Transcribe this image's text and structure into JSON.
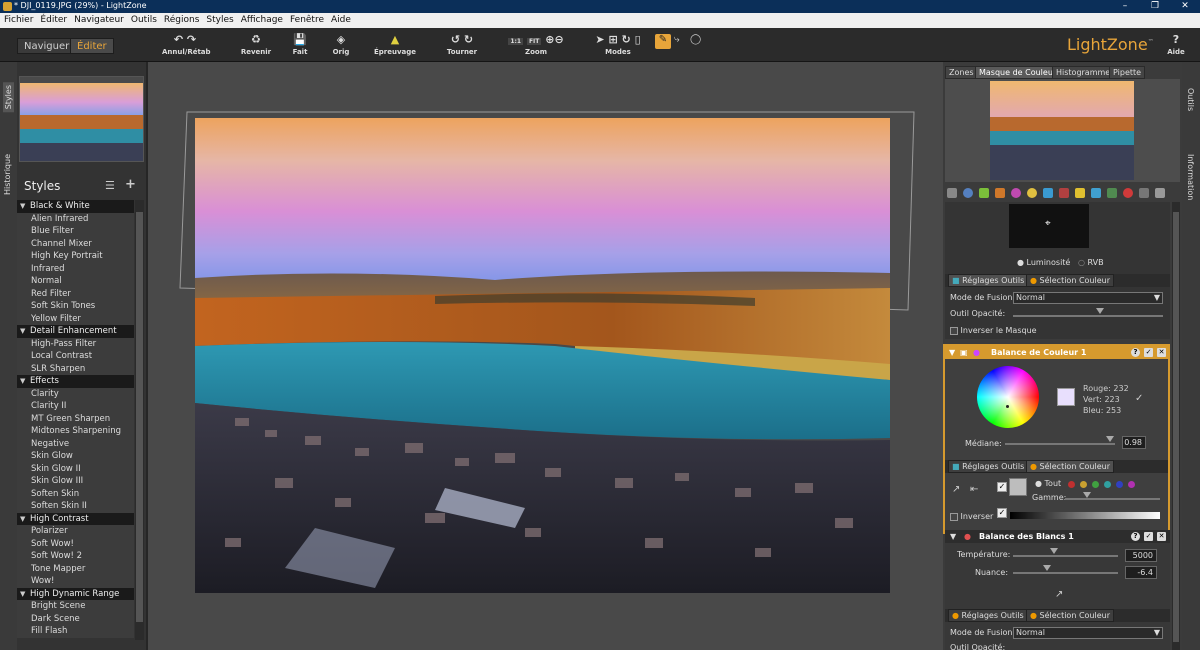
{
  "window": {
    "title": "* DJI_0119.JPG (29%) - LightZone"
  },
  "menu": [
    "Fichier",
    "Éditer",
    "Navigateur",
    "Outils",
    "Régions",
    "Styles",
    "Affichage",
    "Fenêtre",
    "Aide"
  ],
  "modes": {
    "navigate": "Naviguer",
    "edit": "Éditer"
  },
  "toolbar": {
    "undo_redo": "Annul/Rétab",
    "revert": "Revenir",
    "done": "Fait",
    "orig": "Orig",
    "proof": "Épreuvage",
    "rotate": "Tourner",
    "zoom": "Zoom",
    "zoom_1_1": "1:1",
    "zoom_fit": "FIT",
    "modes": "Modes",
    "help": "Aide"
  },
  "brand": "LightZone",
  "side_tabs": {
    "styles": "Styles",
    "history": "Historique",
    "tools": "Outils",
    "info": "Information"
  },
  "styles_panel": {
    "title": "Styles",
    "groups": [
      {
        "name": "Black & White",
        "items": [
          "Alien Infrared",
          "Blue Filter",
          "Channel Mixer",
          "High Key Portrait",
          "Infrared",
          "Normal",
          "Red Filter",
          "Soft Skin Tones",
          "Yellow Filter"
        ]
      },
      {
        "name": "Detail Enhancement",
        "items": [
          "High-Pass Filter",
          "Local Contrast",
          "SLR Sharpen"
        ]
      },
      {
        "name": "Effects",
        "items": [
          "Clarity",
          "Clarity II",
          "MT Green Sharpen",
          "Midtones Sharpening",
          "Negative",
          "Skin Glow",
          "Skin Glow II",
          "Skin Glow III",
          "Soften Skin",
          "Soften Skin II"
        ]
      },
      {
        "name": "High Contrast",
        "items": [
          "Polarizer",
          "Soft Wow!",
          "Soft Wow! 2",
          "Tone Mapper",
          "Wow!"
        ]
      },
      {
        "name": "High Dynamic Range",
        "items": [
          "Bright Scene",
          "Dark Scene",
          "Fill Flash"
        ]
      }
    ]
  },
  "right_tabs": [
    "Zones",
    "Masque de Couleur",
    "Histogramme",
    "Pipette"
  ],
  "mask_panel": {
    "luminosity": "Luminosité",
    "rgb": "RVB",
    "tab_tools": "Réglages Outils",
    "tab_color": "Sélection Couleur",
    "blend_label": "Mode de Fusion:",
    "blend_value": "Normal",
    "opacity_label": "Outil Opacité:",
    "invert_mask": "Inverser le Masque"
  },
  "color_balance": {
    "title": "Balance de Couleur 1",
    "red_label": "Rouge:",
    "red": "232",
    "green_label": "Vert:",
    "green": "223",
    "blue_label": "Bleu:",
    "blue": "253",
    "median_label": "Médiane:",
    "median": "0.98",
    "swatch": "#e8dffd",
    "tab_tools": "Réglages Outils",
    "tab_color": "Sélection Couleur",
    "all": "Tout",
    "gamma": "Gamme:",
    "invert": "Inverser"
  },
  "white_balance": {
    "title": "Balance des Blancs 1",
    "temp_label": "Température:",
    "temp": "5000",
    "tint_label": "Nuance:",
    "tint": "-6.4",
    "tab_tools": "Réglages Outils",
    "tab_color": "Sélection Couleur",
    "blend_label": "Mode de Fusion:",
    "blend_value": "Normal",
    "opacity_label": "Outil Opacité:"
  },
  "colors": {
    "accent": "#d69a2e",
    "titlebar": "#0b2f59"
  }
}
